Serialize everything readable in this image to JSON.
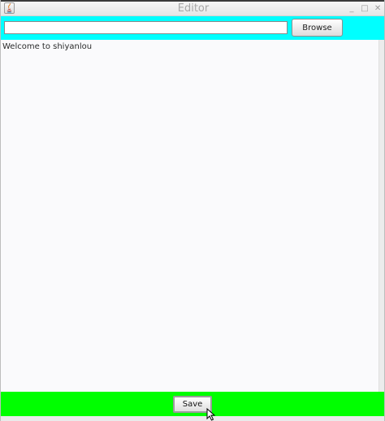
{
  "window": {
    "title": "Editor",
    "controls": {
      "minimize": "_",
      "maximize": "□",
      "close": "✕"
    }
  },
  "toolbar": {
    "path_value": "",
    "path_placeholder": "",
    "browse_label": "Browse",
    "background_color": "#00ffff"
  },
  "editor": {
    "content": "Welcome to shiyanlou",
    "background_color": "#fafafc"
  },
  "footer": {
    "save_label": "Save",
    "background_color": "#00ff00"
  },
  "icons": {
    "app": "java-app-icon",
    "cursor": "mouse-pointer-icon"
  }
}
